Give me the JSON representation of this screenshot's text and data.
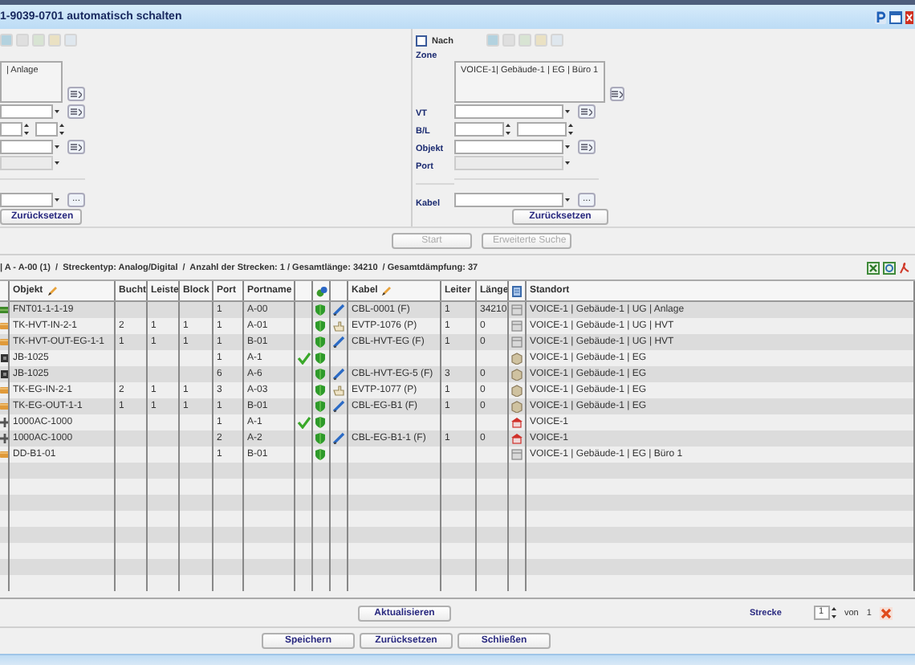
{
  "window": {
    "title": "1-9039-0701 automatisch schalten"
  },
  "source_panel": {
    "location_list": [
      "| Anlage"
    ],
    "fields": [
      {
        "kind": "select-pick"
      },
      {
        "kind": "spin"
      },
      {
        "kind": "select-pick"
      },
      {
        "kind": "disabled"
      }
    ],
    "cable_field": {
      "kind": "select-more",
      "more_button": "..."
    },
    "reset_button": "Zurücksetzen"
  },
  "target_panel": {
    "nach": {
      "label": "Nach",
      "checked": false
    },
    "zone_label": "Zone",
    "location_list": [
      "VOICE-1| Gebäude-1 | EG | Büro 1"
    ],
    "fields": [
      {
        "label": "VT",
        "kind": "select-pick"
      },
      {
        "label": "B/L",
        "kind": "spin"
      },
      {
        "label": "Objekt",
        "kind": "select-pick"
      },
      {
        "label": "Port",
        "kind": "disabled"
      }
    ],
    "cable_field": {
      "label": "Kabel",
      "kind": "select-more",
      "more_button": "..."
    },
    "reset_button": "Zurücksetzen"
  },
  "search_buttons": [
    {
      "label": "Start",
      "disabled": true
    },
    {
      "label": "Erweiterte Suche",
      "disabled": true
    }
  ],
  "summary": "| A - A-00 (1)  /  Streckentyp: Analog/Digital  /  Anzahl der Strecken: 1 / Gesamtlänge: 34210  / Gesamtdämpfung: 37",
  "table": {
    "columns": [
      {
        "kind": "blank"
      },
      {
        "label": "Objekt",
        "kind": "text",
        "editable": true
      },
      {
        "label": "Bucht",
        "kind": "text"
      },
      {
        "label": "Leiste",
        "kind": "text"
      },
      {
        "label": "Block",
        "kind": "text"
      },
      {
        "label": "Port",
        "kind": "text"
      },
      {
        "label": "Portname",
        "kind": "text"
      },
      {
        "kind": "blank"
      },
      {
        "kind": "status-icon"
      },
      {
        "kind": "blank"
      },
      {
        "label": "Kabel",
        "kind": "text",
        "editable": true
      },
      {
        "label": "Leiter",
        "kind": "text"
      },
      {
        "label": "Länge",
        "kind": "text"
      },
      {
        "kind": "doc-icon"
      },
      {
        "label": "Standort",
        "kind": "text"
      }
    ],
    "rows": [
      {
        "object_icon": {
          "kind": "panel"
        },
        "objekt": "FNT01-1-1-19",
        "port": "1",
        "portname": "A-00",
        "checked": false,
        "cable_icon": {
          "kind": "cable"
        },
        "kabel": "CBL-0001 (F)",
        "leiter": "1",
        "laenge": "34210",
        "location_icon": {
          "kind": "rack"
        },
        "standort": "VOICE-1 | Gebäude-1 | UG | Anlage"
      },
      {
        "object_icon": {
          "kind": "module"
        },
        "objekt": "TK-HVT-IN-2-1",
        "bucht": "2",
        "leiste": "1",
        "block": "1",
        "port": "1",
        "portname": "A-01",
        "checked": false,
        "cable_icon": {
          "kind": "hand"
        },
        "kabel": "EVTP-1076 (P)",
        "leiter": "1",
        "laenge": "0",
        "location_icon": {
          "kind": "rack"
        },
        "standort": "VOICE-1 | Gebäude-1 | UG | HVT"
      },
      {
        "object_icon": {
          "kind": "module"
        },
        "objekt": "TK-HVT-OUT-EG-1-1",
        "bucht": "1",
        "leiste": "1",
        "block": "1",
        "port": "1",
        "portname": "B-01",
        "checked": false,
        "cable_icon": {
          "kind": "cable"
        },
        "kabel": "CBL-HVT-EG (F)",
        "leiter": "1",
        "laenge": "0",
        "location_icon": {
          "kind": "rack"
        },
        "standort": "VOICE-1 | Gebäude-1 | UG | HVT"
      },
      {
        "object_icon": {
          "kind": "socket"
        },
        "objekt": "JB-1025",
        "port": "1",
        "portname": "A-1",
        "checked": true,
        "location_icon": {
          "kind": "box"
        },
        "standort": "VOICE-1 | Gebäude-1 | EG"
      },
      {
        "object_icon": {
          "kind": "socket"
        },
        "objekt": "JB-1025",
        "port": "6",
        "portname": "A-6",
        "checked": false,
        "cable_icon": {
          "kind": "cable"
        },
        "kabel": "CBL-HVT-EG-5 (F)",
        "leiter": "3",
        "laenge": "0",
        "location_icon": {
          "kind": "box"
        },
        "standort": "VOICE-1 | Gebäude-1 | EG"
      },
      {
        "object_icon": {
          "kind": "module"
        },
        "objekt": "TK-EG-IN-2-1",
        "bucht": "2",
        "leiste": "1",
        "block": "1",
        "port": "3",
        "portname": "A-03",
        "checked": false,
        "cable_icon": {
          "kind": "hand"
        },
        "kabel": "EVTP-1077 (P)",
        "leiter": "1",
        "laenge": "0",
        "location_icon": {
          "kind": "box"
        },
        "standort": "VOICE-1 | Gebäude-1 | EG"
      },
      {
        "object_icon": {
          "kind": "module"
        },
        "objekt": "TK-EG-OUT-1-1",
        "bucht": "1",
        "leiste": "1",
        "block": "1",
        "port": "1",
        "portname": "B-01",
        "checked": false,
        "cable_icon": {
          "kind": "cable"
        },
        "kabel": "CBL-EG-B1 (F)",
        "leiter": "1",
        "laenge": "0",
        "location_icon": {
          "kind": "box"
        },
        "standort": "VOICE-1 | Gebäude-1 | EG"
      },
      {
        "object_icon": {
          "kind": "switch"
        },
        "objekt": "1000AC-1000",
        "port": "1",
        "portname": "A-1",
        "checked": true,
        "location_icon": {
          "kind": "site"
        },
        "standort": "VOICE-1"
      },
      {
        "object_icon": {
          "kind": "switch"
        },
        "objekt": "1000AC-1000",
        "port": "2",
        "portname": "A-2",
        "checked": false,
        "cable_icon": {
          "kind": "cable"
        },
        "kabel": "CBL-EG-B1-1 (F)",
        "leiter": "1",
        "laenge": "0",
        "location_icon": {
          "kind": "site"
        },
        "standort": "VOICE-1"
      },
      {
        "object_icon": {
          "kind": "module"
        },
        "objekt": "DD-B1-01",
        "port": "1",
        "portname": "B-01",
        "checked": false,
        "location_icon": {
          "kind": "rack"
        },
        "standort": "VOICE-1 | Gebäude-1 | EG | Büro 1"
      }
    ]
  },
  "refresh_button": "Aktualisieren",
  "pager": {
    "label": "Strecke",
    "value": "1",
    "of": "von",
    "total": "1"
  },
  "footer_buttons": [
    "Speichern",
    "Zurücksetzen",
    "Schließen"
  ]
}
